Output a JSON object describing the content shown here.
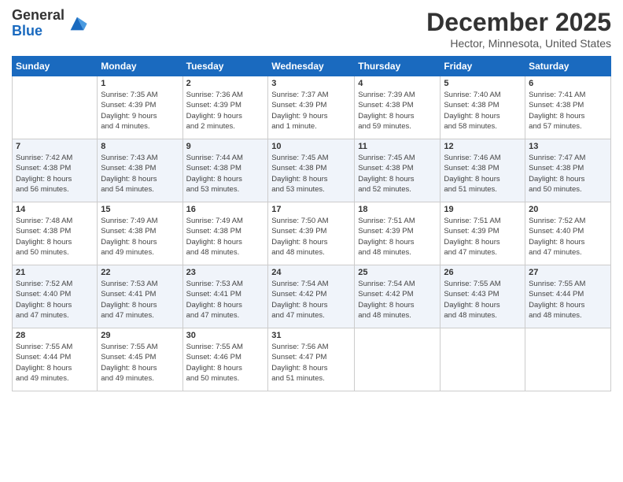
{
  "logo": {
    "general": "General",
    "blue": "Blue"
  },
  "header": {
    "title": "December 2025",
    "subtitle": "Hector, Minnesota, United States"
  },
  "weekdays": [
    "Sunday",
    "Monday",
    "Tuesday",
    "Wednesday",
    "Thursday",
    "Friday",
    "Saturday"
  ],
  "weeks": [
    [
      {
        "day": "",
        "info": ""
      },
      {
        "day": "1",
        "info": "Sunrise: 7:35 AM\nSunset: 4:39 PM\nDaylight: 9 hours\nand 4 minutes."
      },
      {
        "day": "2",
        "info": "Sunrise: 7:36 AM\nSunset: 4:39 PM\nDaylight: 9 hours\nand 2 minutes."
      },
      {
        "day": "3",
        "info": "Sunrise: 7:37 AM\nSunset: 4:39 PM\nDaylight: 9 hours\nand 1 minute."
      },
      {
        "day": "4",
        "info": "Sunrise: 7:39 AM\nSunset: 4:38 PM\nDaylight: 8 hours\nand 59 minutes."
      },
      {
        "day": "5",
        "info": "Sunrise: 7:40 AM\nSunset: 4:38 PM\nDaylight: 8 hours\nand 58 minutes."
      },
      {
        "day": "6",
        "info": "Sunrise: 7:41 AM\nSunset: 4:38 PM\nDaylight: 8 hours\nand 57 minutes."
      }
    ],
    [
      {
        "day": "7",
        "info": "Sunrise: 7:42 AM\nSunset: 4:38 PM\nDaylight: 8 hours\nand 56 minutes."
      },
      {
        "day": "8",
        "info": "Sunrise: 7:43 AM\nSunset: 4:38 PM\nDaylight: 8 hours\nand 54 minutes."
      },
      {
        "day": "9",
        "info": "Sunrise: 7:44 AM\nSunset: 4:38 PM\nDaylight: 8 hours\nand 53 minutes."
      },
      {
        "day": "10",
        "info": "Sunrise: 7:45 AM\nSunset: 4:38 PM\nDaylight: 8 hours\nand 53 minutes."
      },
      {
        "day": "11",
        "info": "Sunrise: 7:45 AM\nSunset: 4:38 PM\nDaylight: 8 hours\nand 52 minutes."
      },
      {
        "day": "12",
        "info": "Sunrise: 7:46 AM\nSunset: 4:38 PM\nDaylight: 8 hours\nand 51 minutes."
      },
      {
        "day": "13",
        "info": "Sunrise: 7:47 AM\nSunset: 4:38 PM\nDaylight: 8 hours\nand 50 minutes."
      }
    ],
    [
      {
        "day": "14",
        "info": "Sunrise: 7:48 AM\nSunset: 4:38 PM\nDaylight: 8 hours\nand 50 minutes."
      },
      {
        "day": "15",
        "info": "Sunrise: 7:49 AM\nSunset: 4:38 PM\nDaylight: 8 hours\nand 49 minutes."
      },
      {
        "day": "16",
        "info": "Sunrise: 7:49 AM\nSunset: 4:38 PM\nDaylight: 8 hours\nand 48 minutes."
      },
      {
        "day": "17",
        "info": "Sunrise: 7:50 AM\nSunset: 4:39 PM\nDaylight: 8 hours\nand 48 minutes."
      },
      {
        "day": "18",
        "info": "Sunrise: 7:51 AM\nSunset: 4:39 PM\nDaylight: 8 hours\nand 48 minutes."
      },
      {
        "day": "19",
        "info": "Sunrise: 7:51 AM\nSunset: 4:39 PM\nDaylight: 8 hours\nand 47 minutes."
      },
      {
        "day": "20",
        "info": "Sunrise: 7:52 AM\nSunset: 4:40 PM\nDaylight: 8 hours\nand 47 minutes."
      }
    ],
    [
      {
        "day": "21",
        "info": "Sunrise: 7:52 AM\nSunset: 4:40 PM\nDaylight: 8 hours\nand 47 minutes."
      },
      {
        "day": "22",
        "info": "Sunrise: 7:53 AM\nSunset: 4:41 PM\nDaylight: 8 hours\nand 47 minutes."
      },
      {
        "day": "23",
        "info": "Sunrise: 7:53 AM\nSunset: 4:41 PM\nDaylight: 8 hours\nand 47 minutes."
      },
      {
        "day": "24",
        "info": "Sunrise: 7:54 AM\nSunset: 4:42 PM\nDaylight: 8 hours\nand 47 minutes."
      },
      {
        "day": "25",
        "info": "Sunrise: 7:54 AM\nSunset: 4:42 PM\nDaylight: 8 hours\nand 48 minutes."
      },
      {
        "day": "26",
        "info": "Sunrise: 7:55 AM\nSunset: 4:43 PM\nDaylight: 8 hours\nand 48 minutes."
      },
      {
        "day": "27",
        "info": "Sunrise: 7:55 AM\nSunset: 4:44 PM\nDaylight: 8 hours\nand 48 minutes."
      }
    ],
    [
      {
        "day": "28",
        "info": "Sunrise: 7:55 AM\nSunset: 4:44 PM\nDaylight: 8 hours\nand 49 minutes."
      },
      {
        "day": "29",
        "info": "Sunrise: 7:55 AM\nSunset: 4:45 PM\nDaylight: 8 hours\nand 49 minutes."
      },
      {
        "day": "30",
        "info": "Sunrise: 7:55 AM\nSunset: 4:46 PM\nDaylight: 8 hours\nand 50 minutes."
      },
      {
        "day": "31",
        "info": "Sunrise: 7:56 AM\nSunset: 4:47 PM\nDaylight: 8 hours\nand 51 minutes."
      },
      {
        "day": "",
        "info": ""
      },
      {
        "day": "",
        "info": ""
      },
      {
        "day": "",
        "info": ""
      }
    ]
  ]
}
